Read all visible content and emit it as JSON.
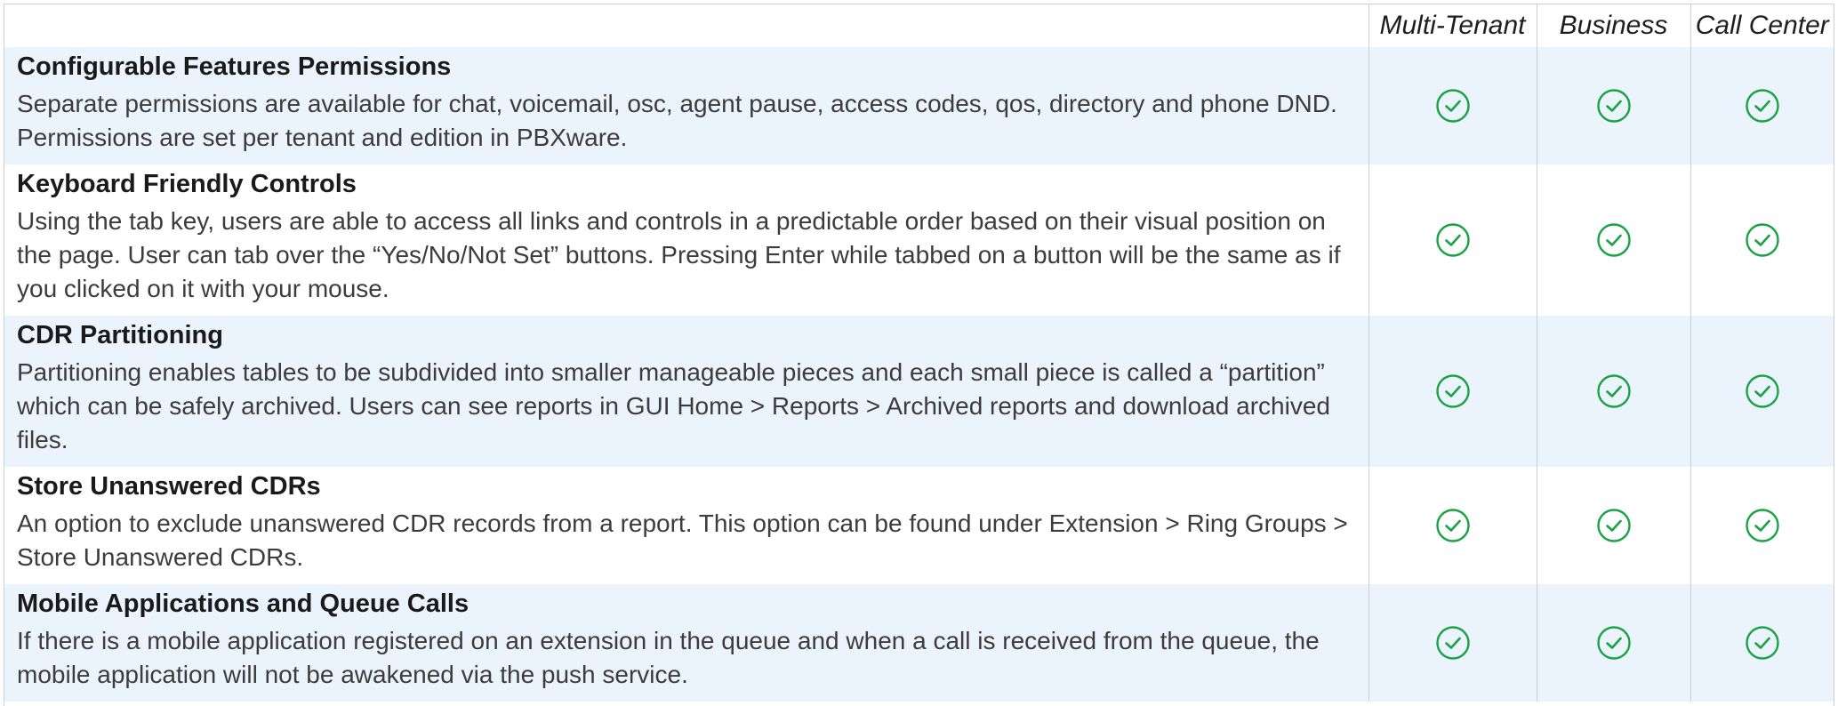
{
  "table": {
    "columns": [
      "Multi-Tenant",
      "Business",
      "Call Center"
    ],
    "rows": [
      {
        "title": "Configurable Features Permissions",
        "description": "Separate permissions are available for chat, voicemail, osc, agent pause, access codes, qos, directory and phone DND. Permissions are set per tenant and edition in PBXware.",
        "multi_tenant": true,
        "business": true,
        "call_center": true
      },
      {
        "title": "Keyboard Friendly Controls",
        "description": "Using the tab key, users are able to access all links and controls in a predictable order based on their visual position on the page. User can tab over the “Yes/No/Not Set” buttons. Pressing Enter while tabbed on a button will be the same as if you clicked on it with your mouse.",
        "multi_tenant": true,
        "business": true,
        "call_center": true
      },
      {
        "title": "CDR Partitioning",
        "description": "Partitioning enables tables to be subdivided into smaller manageable pieces and each small piece is called a “partition” which can be safely archived. Users can see reports in GUI Home > Reports > Archived reports and download archived files.",
        "multi_tenant": true,
        "business": true,
        "call_center": true
      },
      {
        "title": "Store Unanswered CDRs",
        "description": "An option to exclude unanswered CDR records from a report. This option can be found under Extension > Ring Groups > Store Unanswered CDRs.",
        "multi_tenant": true,
        "business": true,
        "call_center": true
      },
      {
        "title": "Mobile Applications and Queue Calls",
        "description": "If there is a mobile application registered on an extension in the queue and when a call is received from the queue, the mobile application will not be awakened via the push service.",
        "multi_tenant": true,
        "business": true,
        "call_center": true
      }
    ]
  },
  "icons": {
    "check": "check-circle-icon"
  },
  "colors": {
    "check": "#1aa344",
    "row_alt": "#ebf3fc",
    "border": "#c8cfd8"
  }
}
